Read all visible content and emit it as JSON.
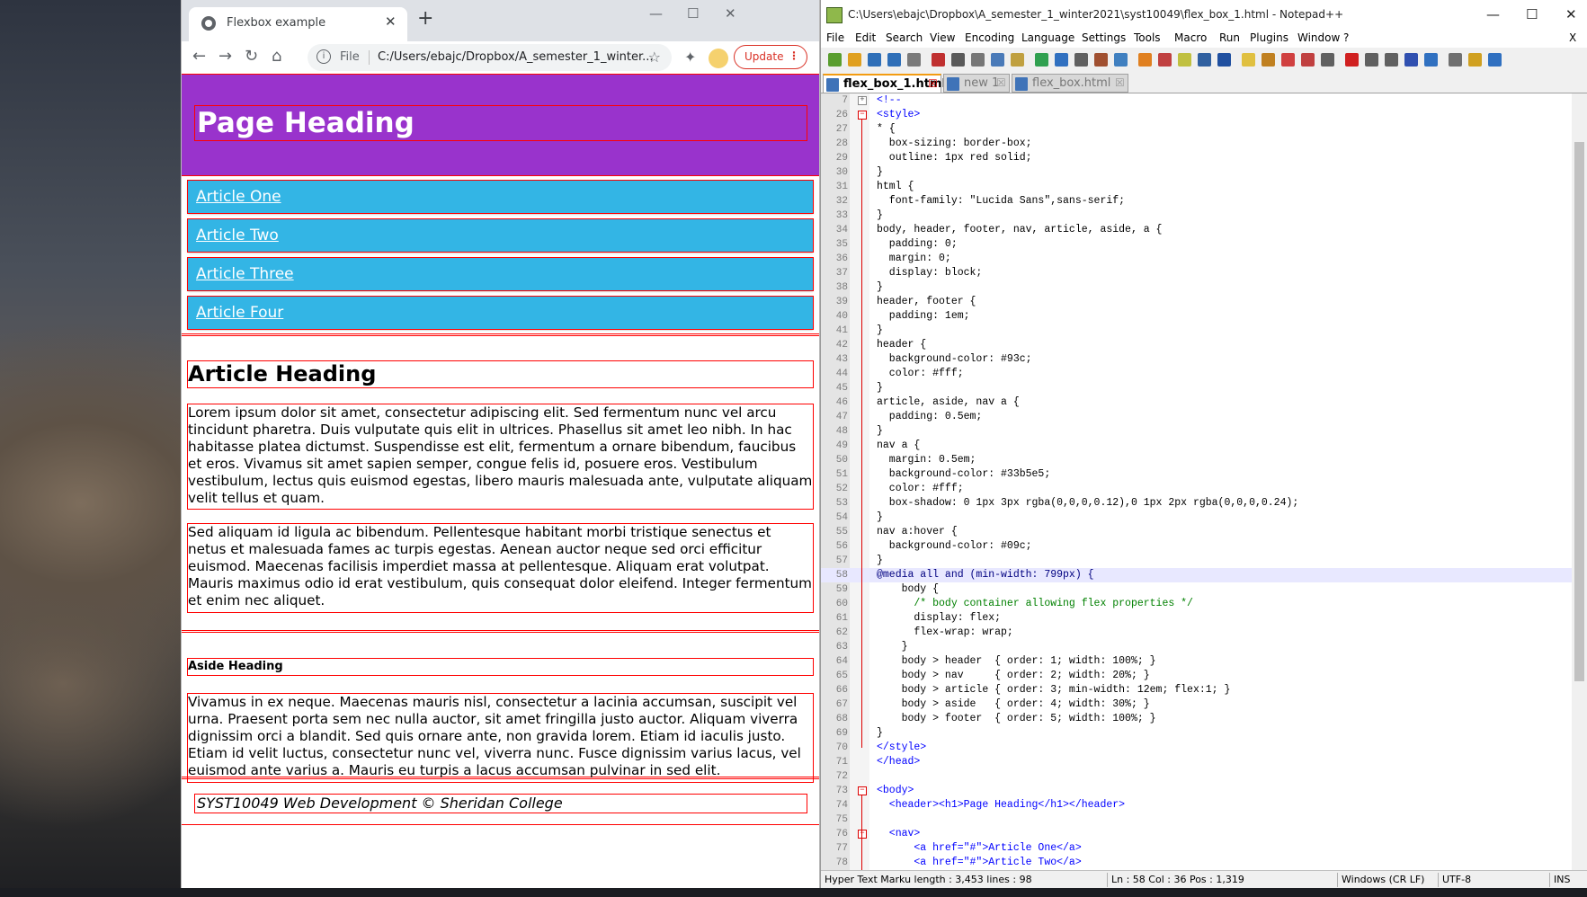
{
  "chrome": {
    "tab_title": "Flexbox example",
    "omnibox_file_label": "File",
    "url": "C:/Users/ebajc/Dropbox/A_semester_1_winter...",
    "update_label": "Update"
  },
  "page": {
    "heading": "Page Heading",
    "nav_links": [
      "Article One",
      "Article Two",
      "Article Three",
      "Article Four"
    ],
    "article_heading": "Article Heading",
    "article_paragraphs": [
      "Lorem ipsum dolor sit amet, consectetur adipiscing elit. Sed fermentum nunc vel arcu tincidunt pharetra. Duis vulputate quis elit in ultrices. Phasellus sit amet leo nibh. In hac habitasse platea dictumst. Suspendisse est elit, fermentum a ornare bibendum, faucibus et eros. Vivamus sit amet sapien semper, congue felis id, posuere eros. Vestibulum vestibulum, lectus quis euismod egestas, libero mauris malesuada ante, vulputate aliquam velit tellus et quam.",
      "Sed aliquam id ligula ac bibendum. Pellentesque habitant morbi tristique senectus et netus et malesuada fames ac turpis egestas. Aenean auctor neque sed orci efficitur euismod. Maecenas facilisis imperdiet massa at pellentesque. Aliquam erat volutpat. Mauris maximus odio id erat vestibulum, quis consequat dolor eleifend. Integer fermentum et enim nec aliquet."
    ],
    "aside_heading": "Aside Heading",
    "aside_paragraph": "Vivamus in ex neque. Maecenas mauris nisl, consectetur a lacinia accumsan, suscipit vel urna. Praesent porta sem nec nulla auctor, sit amet fringilla justo auctor. Aliquam viverra dignissim orci a blandit. Sed quis ornare ante, non gravida lorem. Etiam id iaculis justo. Etiam id velit luctus, consectetur nunc vel, viverra nunc. Fusce dignissim varius lacus, vel euismod ante varius a. Mauris eu turpis a lacus accumsan pulvinar in sed elit.",
    "footer": "SYST10049 Web Development © Sheridan College"
  },
  "npp": {
    "title": "C:\\Users\\ebajc\\Dropbox\\A_semester_1_winter2021\\syst10049\\flex_box_1.html - Notepad++",
    "menu": [
      "File",
      "Edit",
      "Search",
      "View",
      "Encoding",
      "Language",
      "Settings",
      "Tools",
      "Macro",
      "Run",
      "Plugins",
      "Window",
      "?"
    ],
    "close_x": "X",
    "tabs": [
      "flex_box_1.html",
      "new 1",
      "flex_box.html"
    ],
    "lines": [
      {
        "n": "7",
        "fold": "plus",
        "code": "<!--"
      },
      {
        "n": "26",
        "fold": "minus",
        "code": "<style>"
      },
      {
        "n": "27",
        "code": "* {"
      },
      {
        "n": "28",
        "code": "  box-sizing: border-box;"
      },
      {
        "n": "29",
        "code": "  outline: 1px red solid;"
      },
      {
        "n": "30",
        "code": "}"
      },
      {
        "n": "31",
        "code": "html {"
      },
      {
        "n": "32",
        "code": "  font-family: \"Lucida Sans\",sans-serif;"
      },
      {
        "n": "33",
        "code": "}"
      },
      {
        "n": "34",
        "code": "body, header, footer, nav, article, aside, a {"
      },
      {
        "n": "35",
        "code": "  padding: 0;"
      },
      {
        "n": "36",
        "code": "  margin: 0;"
      },
      {
        "n": "37",
        "code": "  display: block;"
      },
      {
        "n": "38",
        "code": "}"
      },
      {
        "n": "39",
        "code": "header, footer {"
      },
      {
        "n": "40",
        "code": "  padding: 1em;"
      },
      {
        "n": "41",
        "code": "}"
      },
      {
        "n": "42",
        "code": "header {"
      },
      {
        "n": "43",
        "code": "  background-color: #93c;"
      },
      {
        "n": "44",
        "code": "  color: #fff;"
      },
      {
        "n": "45",
        "code": "}"
      },
      {
        "n": "46",
        "code": "article, aside, nav a {"
      },
      {
        "n": "47",
        "code": "  padding: 0.5em;"
      },
      {
        "n": "48",
        "code": "}"
      },
      {
        "n": "49",
        "code": "nav a {"
      },
      {
        "n": "50",
        "code": "  margin: 0.5em;"
      },
      {
        "n": "51",
        "code": "  background-color: #33b5e5;"
      },
      {
        "n": "52",
        "code": "  color: #fff;"
      },
      {
        "n": "53",
        "code": "  box-shadow: 0 1px 3px rgba(0,0,0,0.12),0 1px 2px rgba(0,0,0,0.24);"
      },
      {
        "n": "54",
        "code": "}"
      },
      {
        "n": "55",
        "code": "nav a:hover {"
      },
      {
        "n": "56",
        "code": "  background-color: #09c;"
      },
      {
        "n": "57",
        "code": "}"
      },
      {
        "n": "58",
        "code": "@media all and (min-width: 799px) {",
        "current": true
      },
      {
        "n": "59",
        "code": "    body {"
      },
      {
        "n": "60",
        "code": "      /* body container allowing flex properties */"
      },
      {
        "n": "61",
        "code": "      display: flex;"
      },
      {
        "n": "62",
        "code": "      flex-wrap: wrap;"
      },
      {
        "n": "63",
        "code": "    }"
      },
      {
        "n": "64",
        "code": "    body > header  { order: 1; width: 100%; }"
      },
      {
        "n": "65",
        "code": "    body > nav     { order: 2; width: 20%; }"
      },
      {
        "n": "66",
        "code": "    body > article { order: 3; min-width: 12em; flex:1; }"
      },
      {
        "n": "67",
        "code": "    body > aside   { order: 4; width: 30%; }"
      },
      {
        "n": "68",
        "code": "    body > footer  { order: 5; width: 100%; }"
      },
      {
        "n": "69",
        "code": "}"
      },
      {
        "n": "70",
        "code": "</style>"
      },
      {
        "n": "71",
        "code": "</head>"
      },
      {
        "n": "72",
        "code": ""
      },
      {
        "n": "73",
        "fold": "minus",
        "code": "<body>"
      },
      {
        "n": "74",
        "code": "  <header><h1>Page Heading</h1></header>"
      },
      {
        "n": "75",
        "code": ""
      },
      {
        "n": "76",
        "fold": "minus",
        "code": "  <nav>"
      },
      {
        "n": "77",
        "code": "      <a href=\"#\">Article One</a>"
      },
      {
        "n": "78",
        "code": "      <a href=\"#\">Article Two</a>"
      }
    ],
    "status": {
      "type": "Hyper Text Marku length : 3,453    lines : 98",
      "pos": "Ln : 58    Col : 36    Pos : 1,319",
      "eol": "Windows (CR LF)",
      "enc": "UTF-8",
      "mode": "INS"
    }
  },
  "colors": {
    "header_bg": "#9933cc",
    "nav_bg": "#33b5e5",
    "outline": "#ff0000",
    "update_red": "#d93025"
  }
}
